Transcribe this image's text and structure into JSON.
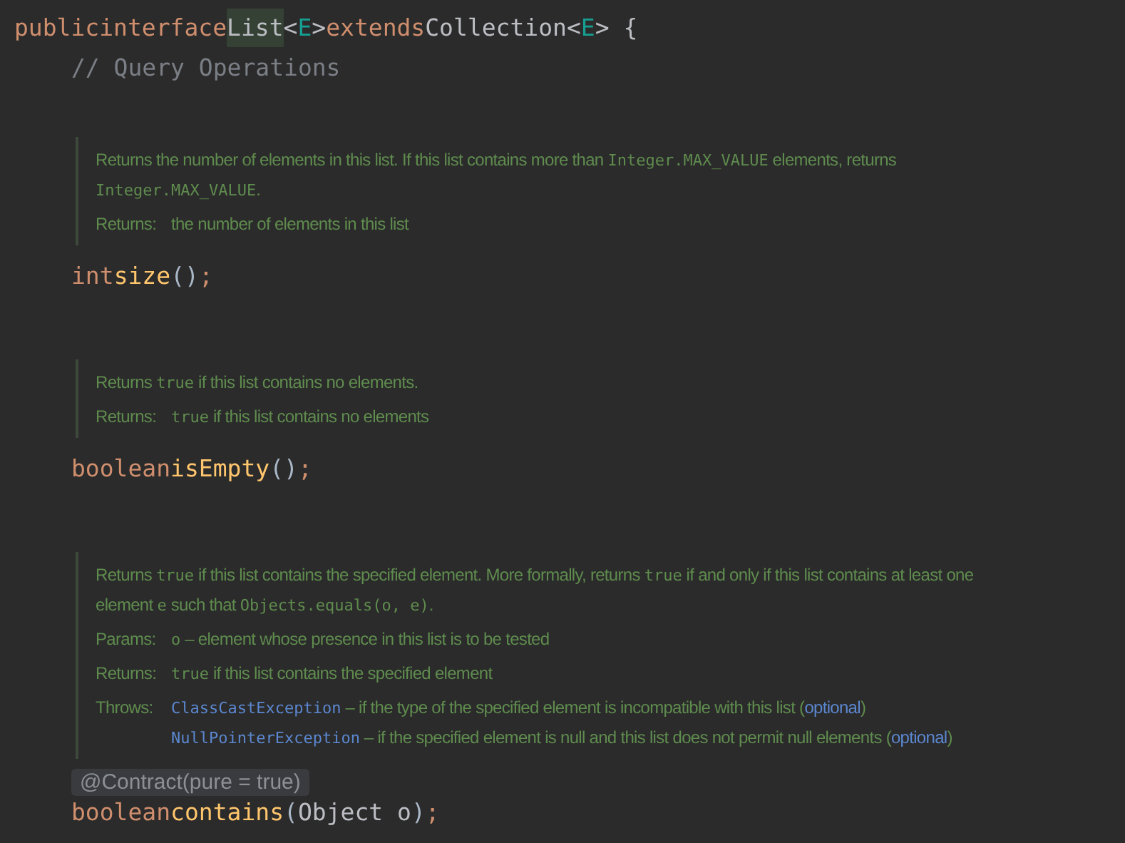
{
  "declaration": {
    "tokens": [
      {
        "kind": "keyword",
        "text": "public"
      },
      {
        "kind": "keyword",
        "text": "interface"
      },
      {
        "kind": "highlight",
        "text": "List"
      },
      {
        "kind": "plain",
        "text": "<"
      },
      {
        "kind": "param",
        "text": "E"
      },
      {
        "kind": "plain",
        "text": ">"
      },
      {
        "kind": "keyword",
        "text": "extends"
      },
      {
        "kind": "plain",
        "text": "Collection<"
      },
      {
        "kind": "param",
        "text": "E"
      },
      {
        "kind": "plain",
        "text": "> {"
      }
    ]
  },
  "members": [
    {
      "kind": "comment",
      "text": "// Query Operations"
    },
    {
      "kind": "doc",
      "description": [
        {
          "kind": "text",
          "text": "Returns the number of elements in this list. If this list contains more than "
        },
        {
          "kind": "code",
          "text": "Integer.MAX_VALUE"
        },
        {
          "kind": "text",
          "text": " elements, returns "
        },
        {
          "kind": "code",
          "text": "Integer.MAX_VALUE"
        },
        {
          "kind": "text",
          "text": "."
        }
      ],
      "tags": [
        {
          "label": "Returns:",
          "entries": [
            [
              {
                "kind": "text",
                "text": "the number of elements in this list"
              }
            ]
          ]
        }
      ]
    },
    {
      "kind": "code",
      "tokens": [
        {
          "kind": "keyword",
          "text": "int"
        },
        {
          "kind": "method",
          "text": "size"
        },
        {
          "kind": "paren",
          "text": "()"
        },
        {
          "kind": "semi",
          "text": ";"
        }
      ]
    },
    {
      "kind": "doc",
      "description": [
        {
          "kind": "text",
          "text": "Returns "
        },
        {
          "kind": "code",
          "text": "true"
        },
        {
          "kind": "text",
          "text": " if this list contains no elements."
        }
      ],
      "tags": [
        {
          "label": "Returns:",
          "entries": [
            [
              {
                "kind": "code",
                "text": "true"
              },
              {
                "kind": "text",
                "text": " if this list contains no elements"
              }
            ]
          ]
        }
      ]
    },
    {
      "kind": "code",
      "tokens": [
        {
          "kind": "keyword",
          "text": "boolean"
        },
        {
          "kind": "method",
          "text": "isEmpty"
        },
        {
          "kind": "paren",
          "text": "()"
        },
        {
          "kind": "semi",
          "text": ";"
        }
      ]
    },
    {
      "kind": "doc",
      "description": [
        {
          "kind": "text",
          "text": "Returns "
        },
        {
          "kind": "code",
          "text": "true"
        },
        {
          "kind": "text",
          "text": " if this list contains the specified element. More formally, returns "
        },
        {
          "kind": "code",
          "text": "true"
        },
        {
          "kind": "text",
          "text": " if and only if this list contains at least one element "
        },
        {
          "kind": "code",
          "text": "e"
        },
        {
          "kind": "text",
          "text": " such that "
        },
        {
          "kind": "code",
          "text": "Objects.equals(o, e)"
        },
        {
          "kind": "text",
          "text": "."
        }
      ],
      "tags": [
        {
          "label": "Params:",
          "entries": [
            [
              {
                "kind": "code",
                "text": "o"
              },
              {
                "kind": "text",
                "text": " – element whose presence in this list is to be tested"
              }
            ]
          ]
        },
        {
          "label": "Returns:",
          "entries": [
            [
              {
                "kind": "code",
                "text": "true"
              },
              {
                "kind": "text",
                "text": " if this list contains the specified element"
              }
            ]
          ]
        },
        {
          "label": "Throws:",
          "entries": [
            [
              {
                "kind": "code-link",
                "text": "ClassCastException"
              },
              {
                "kind": "text",
                "text": " – if the type of the specified element is incompatible with this list ("
              },
              {
                "kind": "link",
                "text": "optional"
              },
              {
                "kind": "text",
                "text": ")"
              }
            ],
            [
              {
                "kind": "code-link",
                "text": "NullPointerException"
              },
              {
                "kind": "text",
                "text": " – if the specified element is null and this list does not permit null elements ("
              },
              {
                "kind": "link",
                "text": "optional"
              },
              {
                "kind": "text",
                "text": ")"
              }
            ]
          ]
        }
      ]
    },
    {
      "kind": "annotation",
      "text": "@Contract(pure = true)"
    },
    {
      "kind": "code",
      "tokens": [
        {
          "kind": "keyword",
          "text": "boolean"
        },
        {
          "kind": "method",
          "text": "contains"
        },
        {
          "kind": "paren",
          "text": "("
        },
        {
          "kind": "plain",
          "text": "Object o"
        },
        {
          "kind": "paren",
          "text": ")"
        },
        {
          "kind": "semi",
          "text": ";"
        }
      ]
    }
  ]
}
